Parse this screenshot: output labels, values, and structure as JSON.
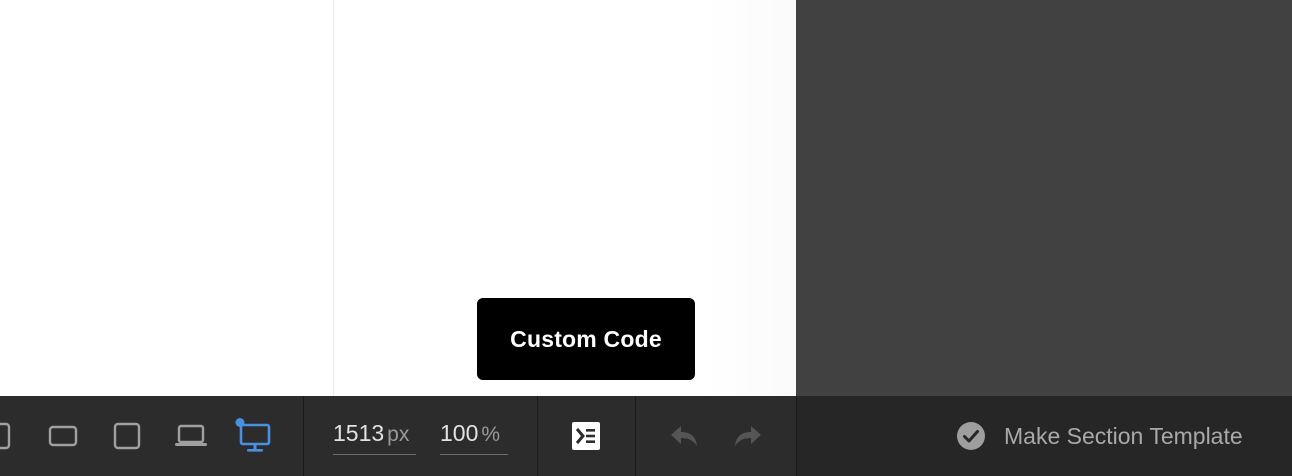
{
  "tooltip": {
    "label": "Custom Code"
  },
  "toolbar": {
    "breakpoints": [
      {
        "name": "mobile-portrait",
        "icon": "phone-portrait-icon",
        "active": false
      },
      {
        "name": "mobile-landscape",
        "icon": "phone-landscape-icon",
        "active": false
      },
      {
        "name": "tablet",
        "icon": "tablet-icon",
        "active": false
      },
      {
        "name": "laptop",
        "icon": "laptop-icon",
        "active": false
      },
      {
        "name": "desktop",
        "icon": "desktop-icon",
        "active": true
      }
    ],
    "width": {
      "value": "1513",
      "unit": "px"
    },
    "zoom": {
      "value": "100",
      "unit": "%"
    },
    "custom_code_icon": "code-icon",
    "undo_icon": "undo-icon",
    "redo_icon": "redo-icon",
    "template_button": {
      "icon": "check-circle-icon",
      "label": "Make Section Template"
    }
  },
  "colors": {
    "accent": "#4a90e2",
    "toolbar_bg": "#2c2c2c",
    "panel_bg": "#414141",
    "tooltip_bg": "#000000"
  }
}
